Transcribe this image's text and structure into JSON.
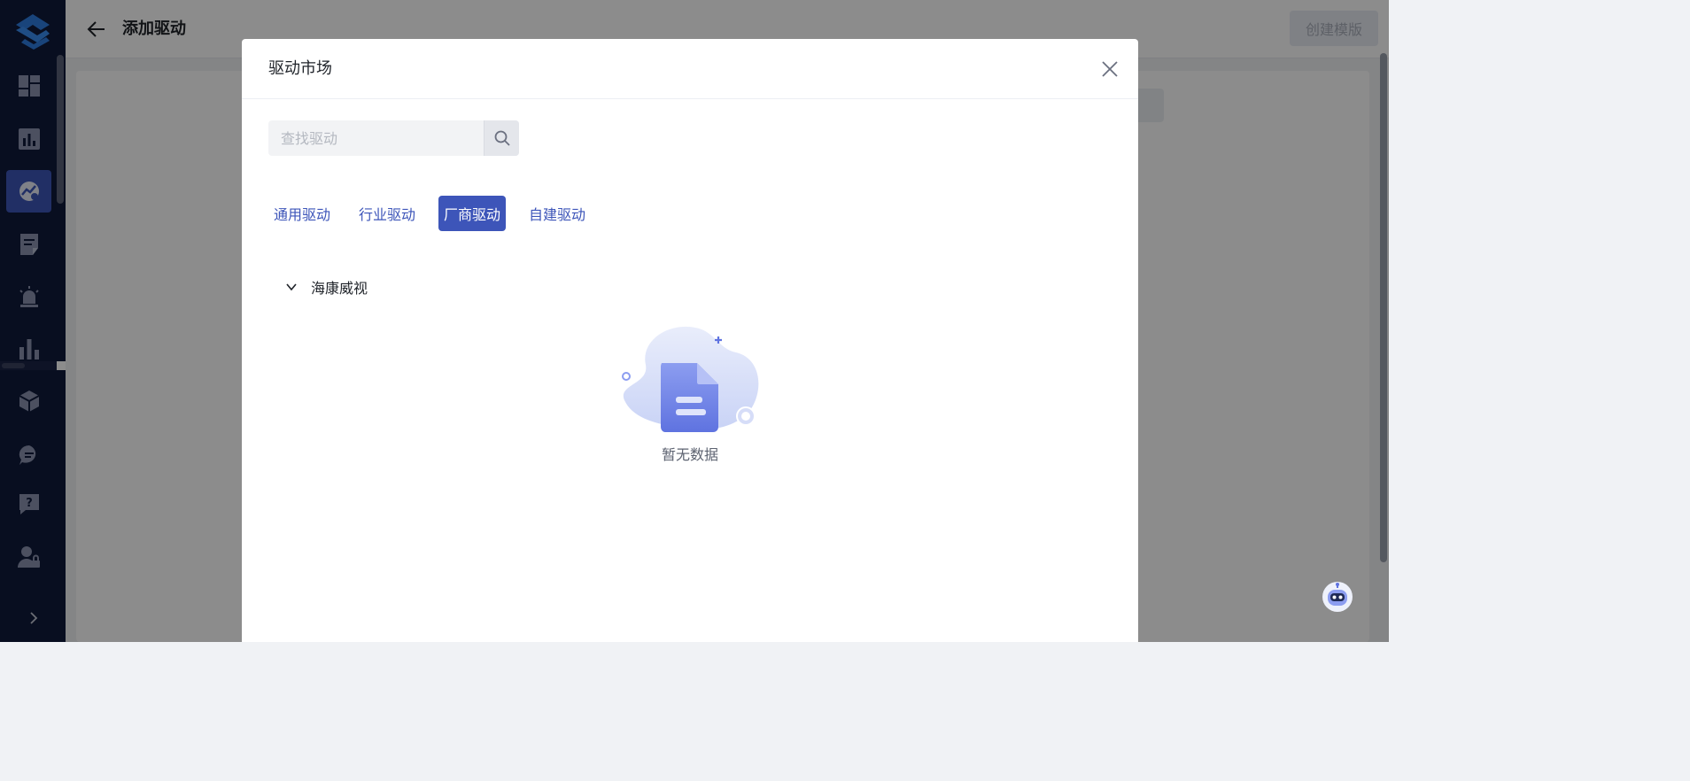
{
  "header": {
    "title": "添加驱动",
    "create_label": "创建模版"
  },
  "sidebar": {
    "items": [
      {
        "icon": "dashboard-icon"
      },
      {
        "icon": "bar-chart-icon"
      },
      {
        "icon": "monitor-gauge-icon",
        "active": true
      },
      {
        "icon": "document-edit-icon"
      },
      {
        "icon": "alarm-light-icon"
      },
      {
        "icon": "statistics-icon"
      },
      {
        "icon": "cube-icon"
      },
      {
        "icon": "chat-icon"
      },
      {
        "icon": "help-icon"
      },
      {
        "icon": "user-lock-icon"
      }
    ]
  },
  "modal": {
    "title": "驱动市场",
    "search": {
      "placeholder": "查找驱动",
      "value": ""
    },
    "tabs": [
      {
        "label": "通用驱动",
        "active": false
      },
      {
        "label": "行业驱动",
        "active": false
      },
      {
        "label": "厂商驱动",
        "active": true
      },
      {
        "label": "自建驱动",
        "active": false
      }
    ],
    "group": {
      "label": "海康威视",
      "expanded": true
    },
    "empty_text": "暂无数据"
  },
  "colors": {
    "sidebar_bg": "#0f1a3b",
    "accent": "#3d55b9",
    "overlay": "rgba(0,0,0,0.45)"
  }
}
